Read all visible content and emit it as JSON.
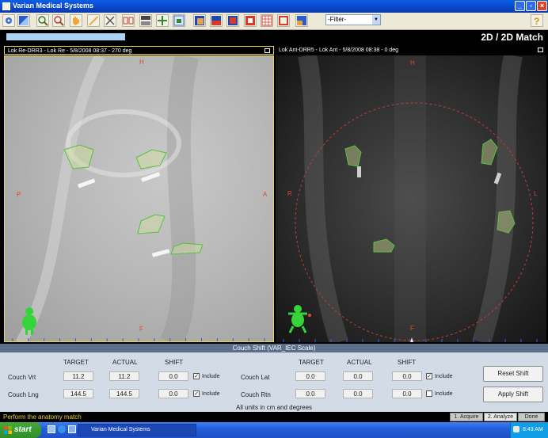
{
  "window": {
    "title": "Varian Medical Systems"
  },
  "toolbar": {
    "filter_value": "-Filter-"
  },
  "header": {
    "mode_title": "2D / 2D Match"
  },
  "left_pane": {
    "title": "Lok Re-DRR3 - Lok Re - 5/8/2008 08:37 - 270 deg",
    "orient_top": "H",
    "orient_left": "P",
    "orient_right": "A",
    "orient_bottom": "F"
  },
  "right_pane": {
    "title": "Lok Ant-DRR5 - Lok Ant - 5/8/2008 08:38 - 0 deg",
    "orient_top": "H",
    "orient_left": "R",
    "orient_right": "L",
    "orient_bottom": "F"
  },
  "couch": {
    "title": "Couch Shift (VAR_IEC Scale)",
    "col_target": "TARGET",
    "col_actual": "ACTUAL",
    "col_shift": "SHIFT",
    "vrt_label": "Couch Vrt",
    "vrt_target": "11.2",
    "vrt_actual": "11.2",
    "vrt_shift": "0.0",
    "lng_label": "Couch Lng",
    "lng_target": "144.5",
    "lng_actual": "144.5",
    "lng_shift": "0.0",
    "lat_label": "Couch Lat",
    "lat_target": "0.0",
    "lat_actual": "0.0",
    "lat_shift": "0.0",
    "rtn_label": "Couch Rtn",
    "rtn_target": "0.0",
    "rtn_actual": "0.0",
    "rtn_shift": "0.0",
    "include_label": "Include",
    "include_vrt": true,
    "include_lng": true,
    "include_lat": true,
    "include_rtn": false,
    "units_note": "All units in cm and degrees",
    "reset_label": "Reset Shift",
    "apply_label": "Apply Shift"
  },
  "status": {
    "message": "Perform the anatomy match",
    "tab_acquire": "1. Acquire",
    "tab_analyze": "2. Analyze",
    "tab_done": "Done"
  },
  "taskbar": {
    "start_label": "start",
    "task_label": "Varian Medical Systems",
    "clock": "8:43 AM"
  }
}
